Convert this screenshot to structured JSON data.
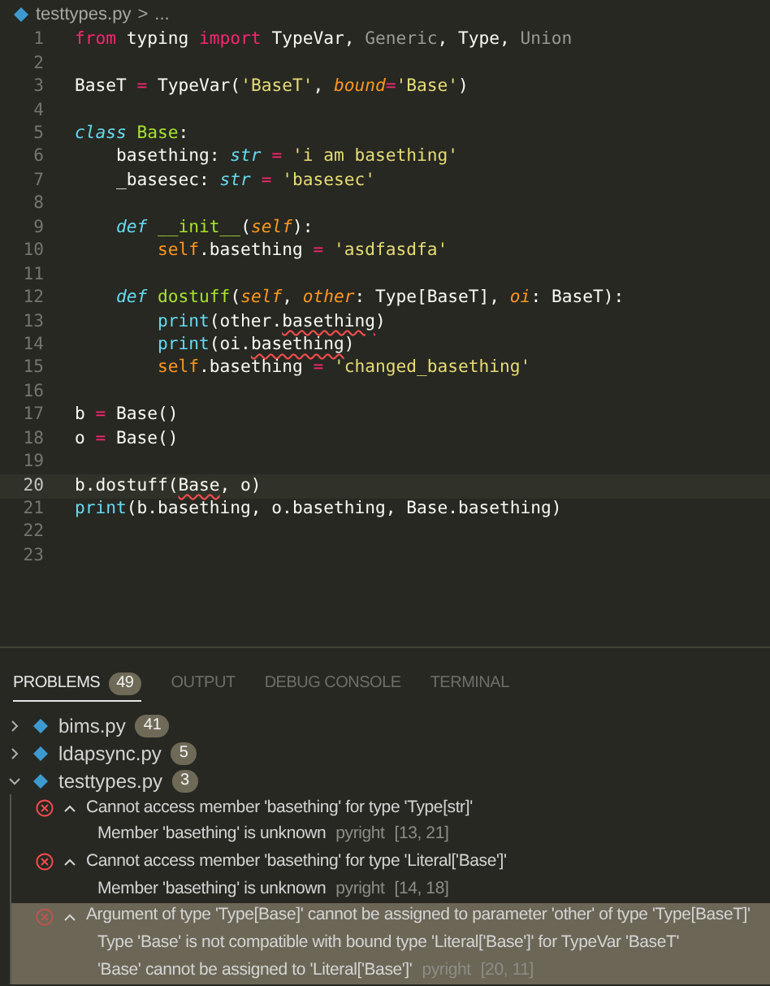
{
  "breadcrumb": {
    "file": "testtypes.py",
    "separator": ">",
    "rest": "..."
  },
  "editor": {
    "lines": [
      {
        "number": "1",
        "current": false,
        "tokens": [
          {
            "kind": "keyword",
            "text": "from"
          },
          {
            "kind": "plain",
            "text": " typing "
          },
          {
            "kind": "keyword",
            "text": "import"
          },
          {
            "kind": "plain",
            "text": " TypeVar, "
          },
          {
            "kind": "dim",
            "text": "Generic"
          },
          {
            "kind": "plain",
            "text": ", Type, "
          },
          {
            "kind": "dim",
            "text": "Union"
          }
        ]
      },
      {
        "number": "2",
        "current": false
      },
      {
        "number": "3",
        "current": false,
        "tokens": [
          {
            "kind": "plain",
            "text": "BaseT"
          },
          {
            "kind": "keyword",
            "text": " = "
          },
          {
            "kind": "plain",
            "text": "TypeVar("
          },
          {
            "kind": "string",
            "text": "'BaseT'"
          },
          {
            "kind": "plain",
            "text": ", "
          },
          {
            "kind": "param",
            "text": "bound"
          },
          {
            "kind": "keyword",
            "text": "="
          },
          {
            "kind": "string",
            "text": "'Base'"
          },
          {
            "kind": "plain",
            "text": ")"
          }
        ]
      },
      {
        "number": "4",
        "current": false
      },
      {
        "number": "5",
        "current": false,
        "tokens": [
          {
            "kind": "storage",
            "text": "class "
          },
          {
            "kind": "func",
            "text": "Base"
          },
          {
            "kind": "plain",
            "text": ":"
          }
        ]
      },
      {
        "number": "6",
        "current": false,
        "tokens": [
          {
            "kind": "plain",
            "text": "    basething: "
          },
          {
            "kind": "type",
            "text": "str"
          },
          {
            "kind": "keyword",
            "text": " = "
          },
          {
            "kind": "string",
            "text": "'i am basething'"
          }
        ]
      },
      {
        "number": "7",
        "current": false,
        "tokens": [
          {
            "kind": "plain",
            "text": "    _basesec: "
          },
          {
            "kind": "type",
            "text": "str"
          },
          {
            "kind": "keyword",
            "text": " = "
          },
          {
            "kind": "string",
            "text": "'basesec'"
          }
        ]
      },
      {
        "number": "8",
        "current": false
      },
      {
        "number": "9",
        "current": false,
        "tokens": [
          {
            "kind": "storage",
            "text": "    def "
          },
          {
            "kind": "func",
            "text": "__init__"
          },
          {
            "kind": "plain",
            "text": "("
          },
          {
            "kind": "param",
            "text": "self"
          },
          {
            "kind": "plain",
            "text": "):"
          }
        ]
      },
      {
        "number": "10",
        "current": false,
        "tokens": [
          {
            "kind": "self",
            "text": "        self"
          },
          {
            "kind": "plain",
            "text": ".basething"
          },
          {
            "kind": "keyword",
            "text": " = "
          },
          {
            "kind": "string",
            "text": "'asdfasdfa'"
          }
        ]
      },
      {
        "number": "11",
        "current": false
      },
      {
        "number": "12",
        "current": false,
        "tokens": [
          {
            "kind": "storage",
            "text": "    def "
          },
          {
            "kind": "func",
            "text": "dostuff"
          },
          {
            "kind": "plain",
            "text": "("
          },
          {
            "kind": "param",
            "text": "self"
          },
          {
            "kind": "plain",
            "text": ", "
          },
          {
            "kind": "param",
            "text": "other"
          },
          {
            "kind": "plain",
            "text": ": Type[BaseT], "
          },
          {
            "kind": "param",
            "text": "oi"
          },
          {
            "kind": "plain",
            "text": ": BaseT):"
          }
        ]
      },
      {
        "number": "13",
        "current": false,
        "tokens": [
          {
            "kind": "builtin",
            "text": "        print"
          },
          {
            "kind": "plain",
            "text": "(other."
          },
          {
            "kind": "error",
            "text": "basething"
          },
          {
            "kind": "plain",
            "text": ")"
          }
        ]
      },
      {
        "number": "14",
        "current": false,
        "tokens": [
          {
            "kind": "builtin",
            "text": "        print"
          },
          {
            "kind": "plain",
            "text": "(oi."
          },
          {
            "kind": "error",
            "text": "basething"
          },
          {
            "kind": "plain",
            "text": ")"
          }
        ]
      },
      {
        "number": "15",
        "current": false,
        "tokens": [
          {
            "kind": "self",
            "text": "        self"
          },
          {
            "kind": "plain",
            "text": ".basething"
          },
          {
            "kind": "keyword",
            "text": " = "
          },
          {
            "kind": "string",
            "text": "'changed_basething'"
          }
        ]
      },
      {
        "number": "16",
        "current": false
      },
      {
        "number": "17",
        "current": false,
        "tokens": [
          {
            "kind": "plain",
            "text": "b"
          },
          {
            "kind": "keyword",
            "text": " = "
          },
          {
            "kind": "plain",
            "text": "Base()"
          }
        ]
      },
      {
        "number": "18",
        "current": false,
        "tokens": [
          {
            "kind": "plain",
            "text": "o"
          },
          {
            "kind": "keyword",
            "text": " = "
          },
          {
            "kind": "plain",
            "text": "Base()"
          }
        ]
      },
      {
        "number": "19",
        "current": false
      },
      {
        "number": "20",
        "current": true,
        "tokens": [
          {
            "kind": "plain",
            "text": "b.dostuff("
          },
          {
            "kind": "error",
            "text": "Base"
          },
          {
            "kind": "plain",
            "text": ", o)"
          }
        ]
      },
      {
        "number": "21",
        "current": false,
        "tokens": [
          {
            "kind": "builtin",
            "text": "print"
          },
          {
            "kind": "plain",
            "text": "(b.basething, o.basething, Base.basething)"
          }
        ]
      },
      {
        "number": "22",
        "current": false
      },
      {
        "number": "23",
        "current": false
      }
    ]
  },
  "panel": {
    "tabs": [
      {
        "label": "PROBLEMS",
        "badge": "49",
        "selected": true
      },
      {
        "label": "OUTPUT",
        "selected": false
      },
      {
        "label": "DEBUG CONSOLE",
        "selected": false
      },
      {
        "label": "TERMINAL",
        "selected": false
      }
    ],
    "files": [
      {
        "name": "bims.py",
        "count": "41",
        "expanded": false
      },
      {
        "name": "ldapsync.py",
        "count": "5",
        "expanded": false
      },
      {
        "name": "testtypes.py",
        "count": "3",
        "expanded": true,
        "problems": [
          {
            "message": "Cannot access member 'basething' for type 'Type[str]'",
            "selected": false,
            "details": [
              {
                "text": "Member 'basething' is unknown",
                "source": "pyright",
                "location": "[13, 21]"
              }
            ]
          },
          {
            "message": "Cannot access member 'basething' for type 'Literal['Base']'",
            "selected": false,
            "details": [
              {
                "text": "Member 'basething' is unknown",
                "source": "pyright",
                "location": "[14, 18]"
              }
            ]
          },
          {
            "message": "Argument of type 'Type[Base]' cannot be assigned to parameter 'other' of type 'Type[BaseT]'",
            "selected": true,
            "details": [
              {
                "text": "Type 'Base' is not compatible with bound type 'Literal['Base']' for TypeVar 'BaseT'"
              },
              {
                "text": "'Base' cannot be assigned to 'Literal['Base']'",
                "source": "pyright",
                "location": "[20, 11]"
              }
            ]
          }
        ]
      }
    ]
  }
}
